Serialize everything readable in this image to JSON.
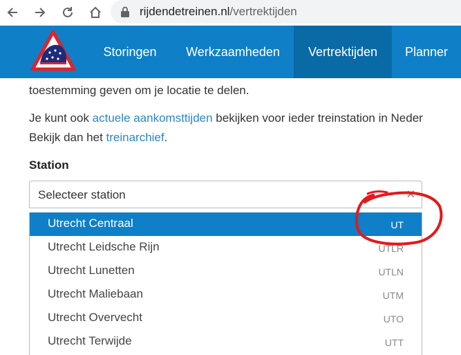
{
  "browser": {
    "url_domain": "rijdendetreinen.nl",
    "url_path": "/vertrektijden"
  },
  "menu": [
    {
      "label": "Storingen"
    },
    {
      "label": "Werkzaamheden"
    },
    {
      "label": "Vertrektijden",
      "active": true
    },
    {
      "label": "Planner"
    }
  ],
  "content": {
    "line1": "toestemming geven om je locatie te delen.",
    "line2_prefix": "Je kunt ook ",
    "line2_link": "actuele aankomsttijden",
    "line2_suffix": " bekijken voor ieder treinstation in Neder",
    "line3_prefix": "Bekijk dan het ",
    "line3_link": "treinarchief",
    "line3_suffix": ".",
    "station_label": "Station"
  },
  "select": {
    "placeholder": "Selecteer station",
    "clear": "×"
  },
  "options": [
    {
      "name": "Utrecht Centraal",
      "code": "UT",
      "active": true
    },
    {
      "name": "Utrecht Leidsche Rijn",
      "code": "UTLR"
    },
    {
      "name": "Utrecht Lunetten",
      "code": "UTLN"
    },
    {
      "name": "Utrecht Maliebaan",
      "code": "UTM"
    },
    {
      "name": "Utrecht Overvecht",
      "code": "UTO"
    },
    {
      "name": "Utrecht Terwijde",
      "code": "UTT"
    }
  ],
  "colors": {
    "header": "#0f7fc7",
    "header_active": "#0a6aa6",
    "link": "#2a86c9",
    "annotation": "#e3191c"
  }
}
